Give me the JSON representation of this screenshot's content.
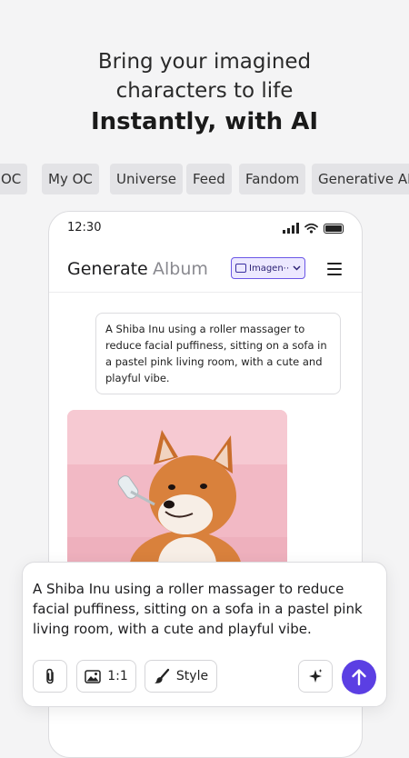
{
  "headline": {
    "line1": "Bring your imagined",
    "line2": "characters to life",
    "line3": "Instantly, with AI"
  },
  "chips": [
    "OC",
    "My OC",
    "Universe",
    "Feed",
    "Fandom",
    "Generative AI"
  ],
  "phone": {
    "status": {
      "time": "12:30"
    },
    "tabs": {
      "generate": "Generate",
      "album": "Album"
    },
    "model_select": {
      "label": "Imagen⋯",
      "icon": "image-icon"
    },
    "prompt_bubble": "A Shiba Inu using a roller massager to reduce facial puffiness, sitting on a sofa in a pastel pink living room, with a cute and playful vibe."
  },
  "composer": {
    "text": "A Shiba Inu using a roller massager to reduce facial puffiness, sitting on a sofa in a pastel pink living room, with a cute and playful vibe.",
    "ratio_label": "1:1",
    "style_label": "Style",
    "icons": [
      "paperclip-icon",
      "image-icon",
      "brush-icon",
      "sparkle-icon",
      "arrow-up-icon"
    ]
  },
  "colors": {
    "accent": "#5b3fe3",
    "select_bg": "#ece8ff",
    "background": "#f4f4f5",
    "image_bg": "#f4c6cf"
  }
}
